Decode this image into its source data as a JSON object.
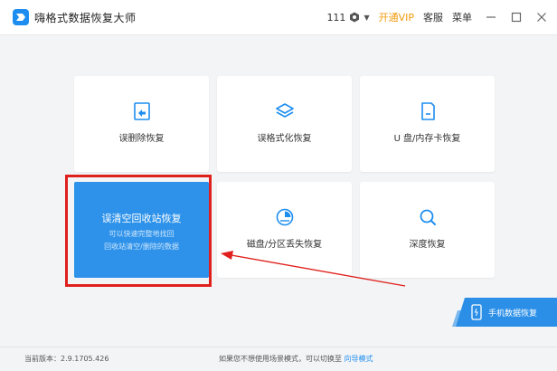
{
  "app": {
    "title": "嗨格式数据恢复大师",
    "user_count": "111",
    "vip_label": "开通VIP",
    "service_label": "客服",
    "menu_label": "菜单",
    "accent_color": "#1d8ef0",
    "vip_color": "#f29a0b"
  },
  "cards": {
    "delete": {
      "label": "误删除恢复",
      "icon": "file-restore-icon"
    },
    "format": {
      "label": "误格式化恢复",
      "icon": "layers-icon"
    },
    "usb": {
      "label": "U 盘/内存卡恢复",
      "icon": "sd-card-icon"
    },
    "recycle": {
      "title": "误清空回收站恢复",
      "sub1": "可以快速完整地找回",
      "sub2": "回收站清空/删除的数据",
      "color": "#2e92ea"
    },
    "disk": {
      "label": "磁盘/分区丢失恢复",
      "icon": "pie-chart-icon"
    },
    "deep": {
      "label": "深度恢复",
      "icon": "magnifier-icon"
    }
  },
  "mobile": {
    "label": "手机数据恢复"
  },
  "status": {
    "version": "当前版本：2.9.1705.426",
    "mode_text": "如果您不想使用场景模式，可以切换至",
    "mode_link": "向导模式"
  },
  "annotation": {
    "highlight_color": "#e0201c"
  }
}
